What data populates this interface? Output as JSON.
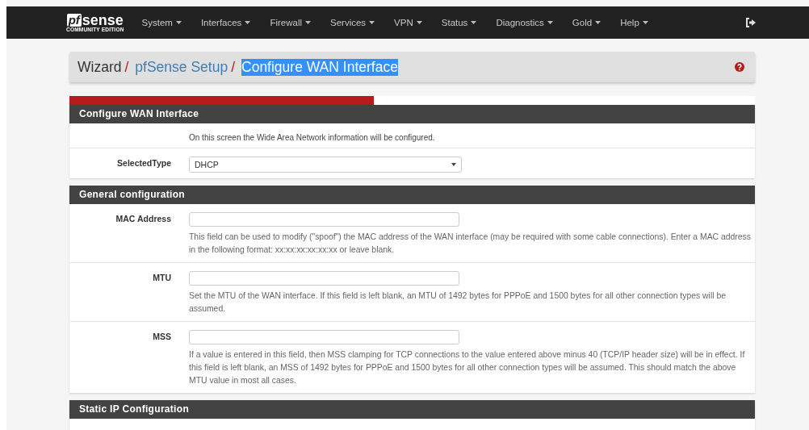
{
  "navbar": {
    "logo": {
      "mark": "pf",
      "word": "sense",
      "edition": "COMMUNITY EDITION"
    },
    "menu": [
      {
        "label": "System"
      },
      {
        "label": "Interfaces"
      },
      {
        "label": "Firewall"
      },
      {
        "label": "Services"
      },
      {
        "label": "VPN"
      },
      {
        "label": "Status"
      },
      {
        "label": "Diagnostics"
      },
      {
        "label": "Gold"
      },
      {
        "label": "Help"
      }
    ]
  },
  "breadcrumb_separator": "/",
  "breadcrumb": [
    {
      "label": "Wizard",
      "kind": "plain",
      "highlighted": false
    },
    {
      "label": "pfSense Setup",
      "kind": "link",
      "highlighted": false
    },
    {
      "label": "Configure WAN Interface",
      "kind": "link",
      "highlighted": true
    }
  ],
  "progress": {
    "level": 0.444
  },
  "sections": [
    {
      "title": "Configure WAN Interface",
      "rows": [
        {
          "kind": "text",
          "label": "",
          "text": "On this screen the Wide Area Network information will be configured."
        },
        {
          "kind": "select",
          "label": "SelectedType",
          "value": "DHCP"
        }
      ]
    },
    {
      "title": "General configuration",
      "rows": [
        {
          "kind": "input",
          "label": "MAC Address",
          "help": "This field can be used to modify (\"spoof\") the MAC address of the WAN interface (may be required with some cable connections). Enter a MAC address in the following format: xx:xx:xx:xx:xx:xx or leave blank."
        },
        {
          "kind": "input",
          "label": "MTU",
          "help": "Set the MTU of the WAN interface. If this field is left blank, an MTU of 1492 bytes for PPPoE and 1500 bytes for all other connection types will be assumed."
        },
        {
          "kind": "input",
          "label": "MSS",
          "help": "If a value is entered in this field, then MSS clamping for TCP connections to the value entered above minus 40 (TCP/IP header size) will be in effect. If this field is left blank, an MSS of 1492 bytes for PPPoE and 1500 bytes for all other connection types will be assumed. This should match the above MTU value in most all cases."
        }
      ]
    },
    {
      "title": "Static IP Configuration"
    }
  ]
}
